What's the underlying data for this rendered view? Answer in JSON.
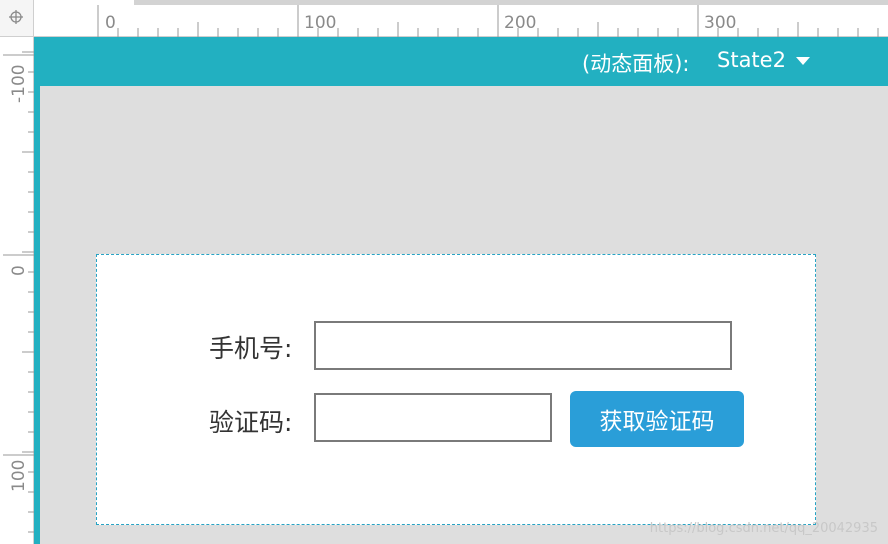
{
  "ruler": {
    "top_labels": [
      "0",
      "100",
      "200",
      "300"
    ],
    "left_labels": [
      "-100",
      "0",
      "100"
    ]
  },
  "panel": {
    "title": "(动态面板):",
    "state": "State2"
  },
  "form": {
    "phone_label": "手机号:",
    "phone_value": "",
    "code_label": "验证码:",
    "code_value": "",
    "get_code_button": "获取验证码"
  },
  "watermark": "https://blog.csdn.net/qq_20042935",
  "colors": {
    "accent": "#22b0c1",
    "button": "#2a9ed8",
    "canvas_bg": "#dedede"
  }
}
